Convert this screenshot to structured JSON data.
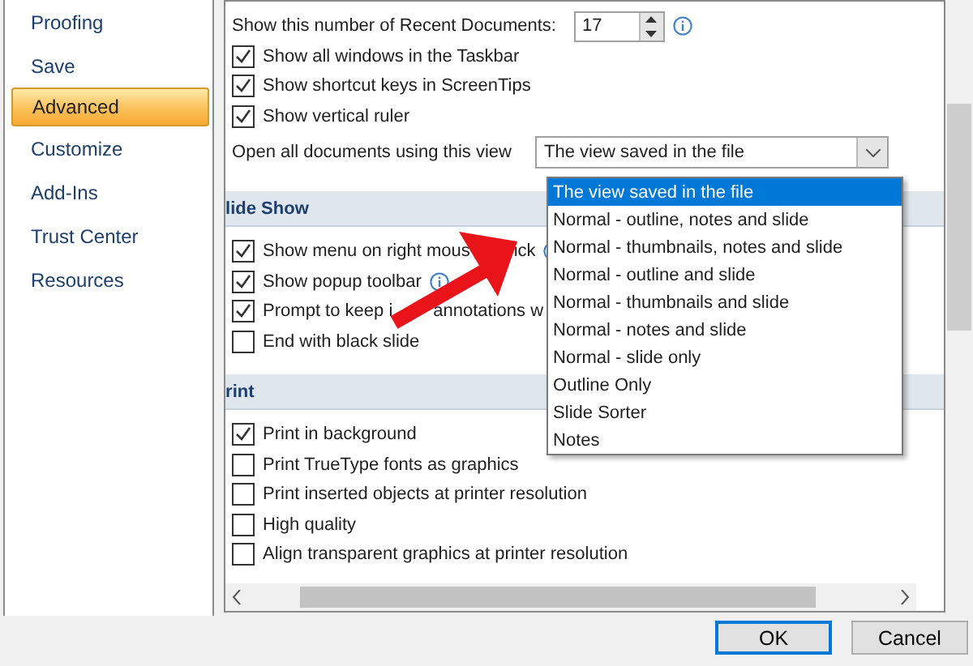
{
  "sidebar": {
    "items": [
      {
        "label": "Proofing",
        "selected": false
      },
      {
        "label": "Save",
        "selected": false
      },
      {
        "label": "Advanced",
        "selected": true
      },
      {
        "label": "Customize",
        "selected": false
      },
      {
        "label": "Add-Ins",
        "selected": false
      },
      {
        "label": "Trust Center",
        "selected": false
      },
      {
        "label": "Resources",
        "selected": false
      }
    ]
  },
  "recent_documents": {
    "label": "Show this number of Recent Documents:",
    "value": "17"
  },
  "display_options": [
    {
      "label": "Show all windows in the Taskbar",
      "checked": true
    },
    {
      "label": "Show shortcut keys in ScreenTips",
      "checked": true
    },
    {
      "label": "Show vertical ruler",
      "checked": true
    }
  ],
  "open_view": {
    "label": "Open all documents using this view",
    "value": "The view saved in the file",
    "options": [
      {
        "label": "The view saved in the file",
        "selected": true
      },
      {
        "label": "Normal - outline, notes and slide",
        "selected": false
      },
      {
        "label": "Normal - thumbnails, notes and slide",
        "selected": false
      },
      {
        "label": "Normal - outline and slide",
        "selected": false
      },
      {
        "label": "Normal - thumbnails and slide",
        "selected": false
      },
      {
        "label": "Normal - notes and slide",
        "selected": false
      },
      {
        "label": "Normal - slide only",
        "selected": false
      },
      {
        "label": "Outline Only",
        "selected": false
      },
      {
        "label": "Slide Sorter",
        "selected": false
      },
      {
        "label": "Notes",
        "selected": false
      }
    ]
  },
  "sections": [
    {
      "title": "lide Show",
      "options": [
        {
          "label": "Show menu on right mous",
          "tail": "ick",
          "checked": true,
          "info": true
        },
        {
          "label": "Show popup toolbar",
          "checked": true,
          "info": true
        },
        {
          "label": "Prompt to keep i",
          "tail": "annotations w",
          "checked": true,
          "info": false
        },
        {
          "label": "End with black slide",
          "checked": false,
          "info": false
        }
      ]
    },
    {
      "title": "rint",
      "options": [
        {
          "label": "Print in background",
          "checked": true,
          "info": false
        },
        {
          "label": "Print TrueType fonts as graphics",
          "checked": false,
          "info": false
        },
        {
          "label": "Print inserted objects at printer resolution",
          "checked": false,
          "info": false
        },
        {
          "label": "High quality",
          "checked": false,
          "info": false
        },
        {
          "label": "Align transparent graphics at printer resolution",
          "checked": false,
          "info": false
        }
      ]
    }
  ],
  "buttons": [
    {
      "label": "OK",
      "kind": "default"
    },
    {
      "label": "Cancel",
      "kind": "normal"
    }
  ]
}
